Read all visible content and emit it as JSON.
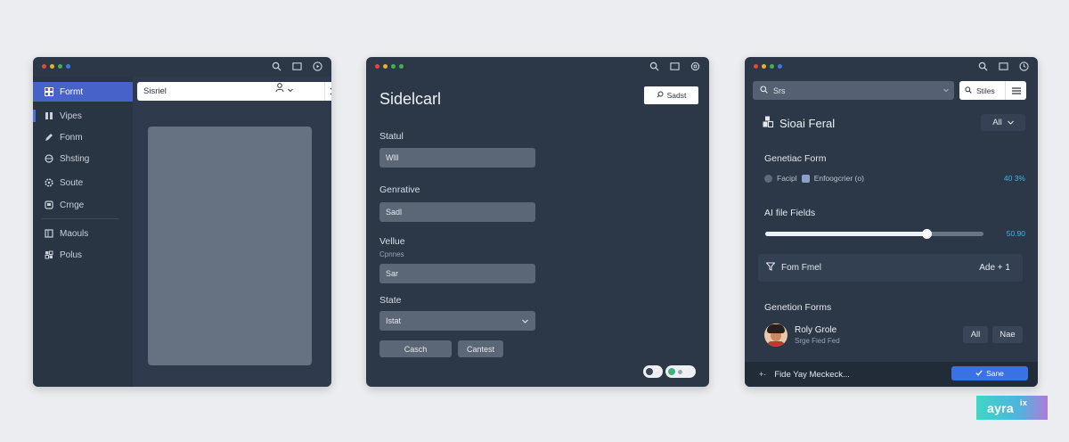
{
  "window1": {
    "sidebar": {
      "items": [
        {
          "label": "Formt",
          "icon": "grid-icon",
          "active": true
        },
        {
          "label": "Vipes",
          "icon": "columns-icon",
          "active": false
        },
        {
          "label": "Fonm",
          "icon": "pen-icon",
          "active": false
        },
        {
          "label": "Shsting",
          "icon": "globe-icon",
          "active": false
        },
        {
          "label": "Soute",
          "icon": "settings-icon",
          "active": false
        },
        {
          "label": "Crnge",
          "icon": "square-icon",
          "active": false
        },
        {
          "label": "Maouls",
          "icon": "layout-icon",
          "active": false
        },
        {
          "label": "Polus",
          "icon": "grid-small-icon",
          "active": false
        }
      ]
    },
    "search": {
      "value": "Sisriel"
    }
  },
  "window2": {
    "title": "Sidelcarl",
    "button_label": "Sadst",
    "fields": [
      {
        "label": "Statul",
        "value": "Wlll"
      },
      {
        "label": "Genrative",
        "value": "Sadl"
      },
      {
        "label": "Vellue",
        "sublabel": "Cpnnes",
        "value": "Sar"
      },
      {
        "label": "State",
        "value": "Istat"
      }
    ],
    "buttons": {
      "left": "Casch",
      "right": "Cantest"
    }
  },
  "window3": {
    "search": {
      "value": "Srs"
    },
    "filter_button": "Stiles",
    "header": {
      "title": "Sioai Feral",
      "dropdown": "All"
    },
    "genetic_form": {
      "title": "Genetiac Form",
      "chip1": "Facipl",
      "chip2": "Enfoogcrier (o)",
      "value": "40 3%"
    },
    "ai_file_fields": {
      "title": "AI file Fields",
      "value_label": "50.90",
      "slider_value": 0.74
    },
    "form_row": {
      "label": "Fom Fmel",
      "action": "Ade + 1"
    },
    "generation_forms": {
      "title": "Genetion Forms"
    },
    "profile": {
      "name": "Roly Grole",
      "subtitle": "Srge Fied Fed"
    },
    "pills": {
      "all": "All",
      "new": "Nae"
    },
    "footer": {
      "text": "Fide Yay Meckeck...",
      "save": "Sane"
    }
  },
  "brand": {
    "name": "ayra",
    "suffix": "ix"
  },
  "colors": {
    "accent": "#4763c9",
    "save": "#3a72e4",
    "highlight": "#3fb4e8"
  }
}
